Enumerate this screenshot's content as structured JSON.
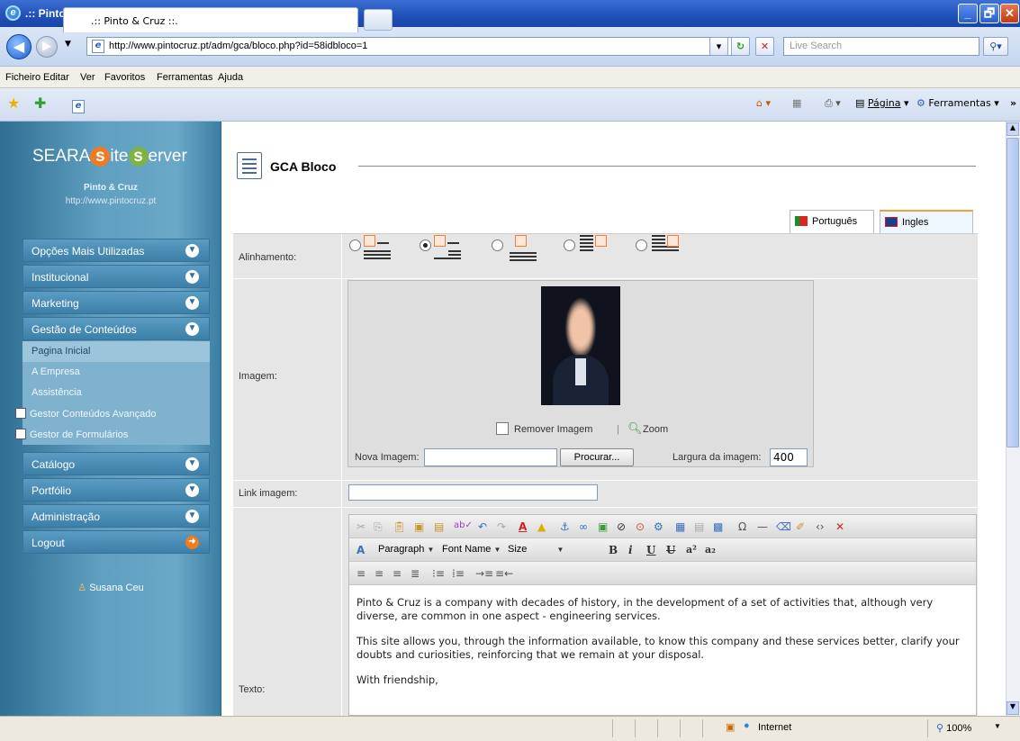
{
  "window": {
    "title": ".:: Pinto & Cruz ::. - Windows Internet Explorer",
    "minimize": "_",
    "restore": "🗗",
    "close": "✕"
  },
  "address": {
    "url": "http://www.pintocruz.pt/adm/gca/bloco.php?id=58idbloco=1",
    "search_placeholder": "Live Search"
  },
  "menu": [
    "Ficheiro",
    "Editar",
    "Ver",
    "Favoritos",
    "Ferramentas",
    "Ajuda"
  ],
  "tab": {
    "title": ".:: Pinto & Cruz ::.",
    "pagina": "Página",
    "ferramentas": "Ferramentas"
  },
  "sidebar": {
    "brand_part1": "SEARA",
    "brand_s": "s",
    "brand_ite": "ite",
    "brand_e": "s",
    "brand_erver": "erver",
    "company": "Pinto & Cruz",
    "company_url": "http://www.pintocruz.pt",
    "items": [
      {
        "label": "Opções Mais Utilizadas"
      },
      {
        "label": "Institucional"
      },
      {
        "label": "Marketing"
      },
      {
        "label": "Gestão de Conteúdos"
      }
    ],
    "subitems": [
      "Pagina Inicial",
      "A Empresa",
      "Assistência",
      "Gestor Conteúdos Avançado",
      "Gestor de Formulários"
    ],
    "items2": [
      "Catálogo",
      "Portfólio",
      "Administração",
      "Logout"
    ],
    "user": "Susana Ceu"
  },
  "main": {
    "title": "GCA Bloco",
    "lang_pt": "Português",
    "lang_en": "Ingles",
    "alinhamento": "Alinhamento:",
    "imagem": "Imagem:",
    "link_imagem": "Link imagem:",
    "texto": "Texto:",
    "remover": "Remover Imagem",
    "zoom": "Zoom",
    "nova_imagem": "Nova Imagem:",
    "procurar": "Procurar...",
    "largura": "Largura da imagem:",
    "largura_val": "400",
    "editor": {
      "format": "Paragraph",
      "font": "Font Name",
      "size": "Size"
    },
    "content": [
      "Pinto & Cruz is a company with decades of history, in the development of a set of activities that, although very diverse, are common in one aspect - engineering services.",
      "This site allows you, through the information available, to know this company and these services better, clarify your doubts and curiosities, reinforcing that we remain at your disposal.",
      "With friendship,"
    ]
  },
  "status": {
    "zone": "Internet",
    "zoom": "100%"
  }
}
